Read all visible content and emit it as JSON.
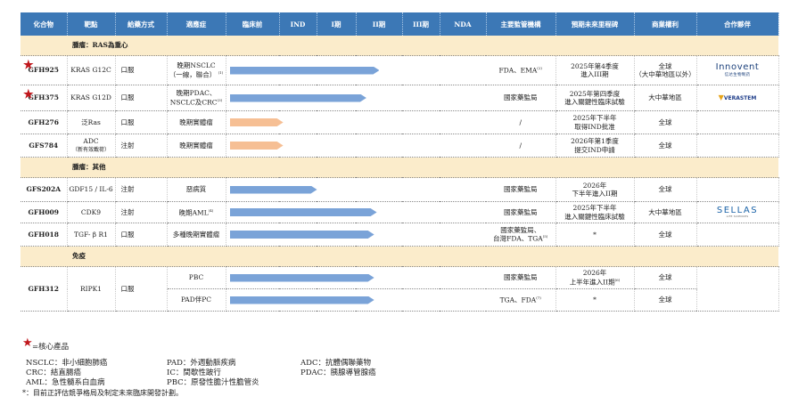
{
  "headers": [
    "化合物",
    "靶點",
    "給藥方式",
    "適應症",
    "臨床前",
    "IND",
    "I期",
    "II期",
    "III期",
    "NDA",
    "主要監管機構",
    "預期未來里程碑",
    "商業權利",
    "合作夥伴"
  ],
  "sections": {
    "oncology_ras": "腫瘤：RAS為重心",
    "oncology_other": "腫瘤：其他",
    "immunology": "免疫"
  },
  "rows": {
    "gfh925": {
      "compound": "GFH925",
      "target": "KRAS G12C",
      "route": "口服",
      "indication": "晚期NSCLC",
      "indication2": "（一線，聯合）",
      "note": "(1)",
      "regulator": "FDA、EMA",
      "reg_note": "(2)",
      "milestone": "2025年第4季度",
      "milestone2": "進入III期",
      "rights": "全球",
      "rights2": "（大中華地區以外）",
      "partner": "Innovent",
      "partner_sub": "信达生物制药",
      "progress": 0.59,
      "bar_color": "#7aa3d8"
    },
    "gfh375": {
      "compound": "GFH375",
      "target": "KRAS G12D",
      "route": "口服",
      "indication": "晚期PDAC、",
      "indication2": "NSCLC及CRC",
      "note": "(3)",
      "regulator": "國家藥監局",
      "milestone": "2025年第四季度",
      "milestone2": "進入關鍵性臨床試驗",
      "rights": "大中華地區",
      "partner": "VERASTEM",
      "progress": 0.54,
      "bar_color": "#7aa3d8"
    },
    "gfh276": {
      "compound": "GFH276",
      "target": "泛Ras",
      "route": "口服",
      "indication": "晚期實體瘤",
      "regulator": "/",
      "milestone": "2025年下半年",
      "milestone2": "取得IND批准",
      "rights": "全球",
      "partner": "",
      "progress": 0.22,
      "bar_color": "#f6bf94"
    },
    "gfs784": {
      "compound": "GFS784",
      "target": "ADC",
      "target2": "（新有效載荷）",
      "route": "注射",
      "indication": "晚期實體瘤",
      "regulator": "/",
      "milestone": "2026年第1季度",
      "milestone2": "提交IND申請",
      "rights": "全球",
      "partner": "",
      "progress": 0.22,
      "bar_color": "#f6bf94"
    },
    "gfs202a": {
      "compound": "GFS202A",
      "target": "GDF15 / IL-6",
      "route": "注射",
      "indication": "惡病質",
      "regulator": "國家藥監局",
      "milestone": "2026年",
      "milestone2": "下半年進入II期",
      "rights": "全球",
      "partner": "",
      "progress": 0.35,
      "bar_color": "#7aa3d8"
    },
    "gfh009": {
      "compound": "GFH009",
      "target": "CDK9",
      "route": "注射",
      "indication": "晚期AML",
      "note": "(4)",
      "regulator": "國家藥監局",
      "milestone": "2025年下半年",
      "milestone2": "進入關鍵性臨床試驗",
      "rights": "大中華地區",
      "partner": "SELLAS",
      "partner_sub": "LIFE SCIENCES",
      "progress": 0.58,
      "bar_color": "#7aa3d8"
    },
    "gfh018": {
      "compound": "GFH018",
      "target": "TGF- β R1",
      "route": "口服",
      "indication": "多種晚期實體瘤",
      "regulator": "國家藥監局、",
      "regulator2": "台灣FDA、TGA",
      "reg_note": "(5)",
      "milestone": "*",
      "rights": "全球",
      "partner": "",
      "progress": 0.57,
      "bar_color": "#7aa3d8"
    },
    "gfh312": {
      "compound": "GFH312",
      "target": "RIPK1",
      "route": "口服",
      "partner": ""
    },
    "gfh312_pbc": {
      "indication": "PBC",
      "regulator": "國家藥監局",
      "milestone": "2026年",
      "milestone2": "上半年進入II期",
      "mil_note": "(6)",
      "rights": "全球",
      "progress": 0.57,
      "bar_color": "#7aa3d8"
    },
    "gfh312_pad": {
      "indication": "PAD伴PC",
      "regulator": "TGA、FDA",
      "reg_note": "(7)",
      "milestone": "*",
      "rights": "全球",
      "progress": 0.57,
      "bar_color": "#7aa3d8"
    }
  },
  "legend": {
    "core": "=核心產品",
    "nsclc": "NSCLC：非小細胞肺癌",
    "crc": "CRC：結直腸癌",
    "aml": "AML：急性髓系白血病",
    "pad": "PAD：外週動脈疾病",
    "ic": "IC：間歇性跛行",
    "pbc": "PBC：原發性膽汁性膽管炎",
    "adc": "ADC：抗體偶聯藥物",
    "pdac": "PDAC：胰腺導管腺癌",
    "footnote": "*：目前正評估競爭格局及制定未來臨床開發計劃。"
  },
  "colors": {
    "header_bg": "#3c78b6",
    "section_bg": "#fbeccb",
    "bar_blue": "#7aa3d8",
    "bar_orange": "#f6bf94",
    "star": "#c0171c"
  }
}
